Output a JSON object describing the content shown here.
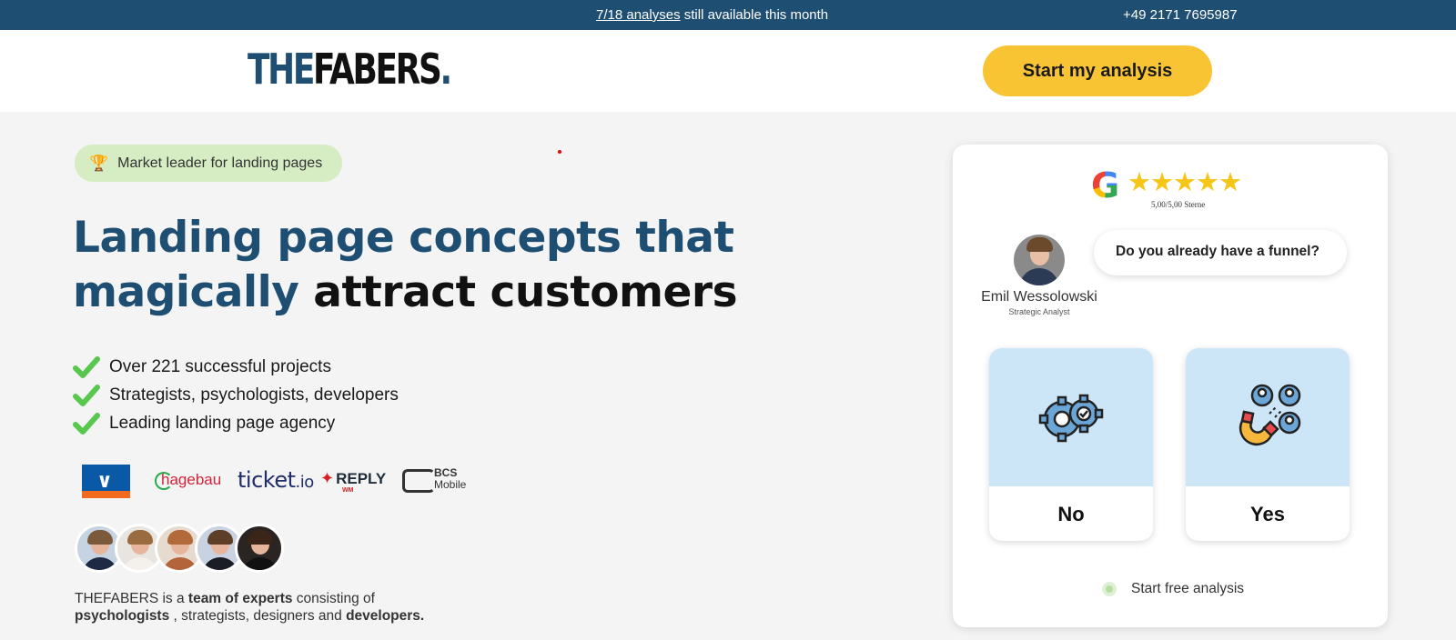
{
  "topbar": {
    "promo_link": "7/18 analyses",
    "promo_rest": " still available this month",
    "phone": "+49 2171 7695987"
  },
  "header": {
    "logo_the": "THE",
    "logo_fabers": "FABERS",
    "logo_dot": ".",
    "cta_label": "Start my analysis"
  },
  "hero": {
    "badge_label": "Market leader for landing pages",
    "badge_icon": "trophy-icon",
    "headline_line1": "Landing page concepts that",
    "headline_blue2": "magically",
    "headline_dark2": " attract customers",
    "bullets": [
      "Over 221 successful projects",
      "Strategists, psychologists, developers",
      "Leading landing page agency"
    ],
    "clients": {
      "hagebau": "hagebau",
      "ticket": "ticket",
      "ticket_io": ".io",
      "reply": "REPLY",
      "reply_wm": "WM",
      "bcs_line1": "BCS",
      "bcs_line2": "Mobile"
    },
    "team_a": "THEFABERS is a ",
    "team_b": "team of experts",
    "team_c": " consisting of",
    "team_d": "psychologists",
    "team_e": " , strategists, designers and ",
    "team_f": "developers."
  },
  "card": {
    "google_letter": "G",
    "stars": "★★★★★",
    "rating_text": "5,00/5,00 Sterne",
    "analyst_name": "Emil Wessolowski",
    "analyst_role": "Strategic Analyst",
    "question": "Do you already have a funnel?",
    "options": [
      {
        "label": "No",
        "icon": "gears-icon"
      },
      {
        "label": "Yes",
        "icon": "magnet-users-icon"
      }
    ],
    "footer_label": "Start free analysis"
  },
  "colors": {
    "brand_blue": "#1f4e73",
    "cta_yellow": "#f9c433",
    "check_green": "#57c84d",
    "option_blue": "#cce6f8"
  }
}
